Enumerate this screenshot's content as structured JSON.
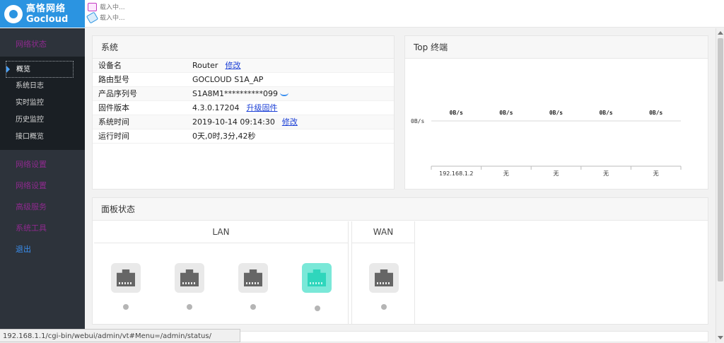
{
  "brand": {
    "name_cn": "高恪网络",
    "name_en": "Gocloud"
  },
  "loading": [
    "载入中...",
    "载入中..."
  ],
  "sidebar": {
    "status_head": "网络状态",
    "sub_items": [
      "概览",
      "系统日志",
      "实时监控",
      "历史监控",
      "接口概览"
    ],
    "items": [
      "网络设置",
      "网络设置",
      "高级服务",
      "系统工具"
    ],
    "exit": "退出"
  },
  "system": {
    "title": "系统",
    "rows": [
      {
        "label": "设备名",
        "value": "Router",
        "link": "修改"
      },
      {
        "label": "路由型号",
        "value": "GOCLOUD S1A_AP",
        "link": ""
      },
      {
        "label": "产品序列号",
        "value": "S1A8M1**********099",
        "link": ""
      },
      {
        "label": "固件版本",
        "value": "4.3.0.17204",
        "link": "升级固件"
      },
      {
        "label": "系统时间",
        "value": "2019-10-14 09:14:30",
        "link": "修改"
      },
      {
        "label": "运行时间",
        "value": "0天,0时,3分,42秒",
        "link": ""
      }
    ]
  },
  "top_terminals": {
    "title": "Top 终端",
    "y_label": "0B/s",
    "speed_labels": [
      "0B/s",
      "0B/s",
      "0B/s",
      "0B/s",
      "0B/s"
    ],
    "x_labels": [
      "192.168.1.2",
      "无",
      "无",
      "无",
      "无"
    ]
  },
  "chart_data": {
    "type": "bar",
    "title": "Top 终端",
    "categories": [
      "192.168.1.2",
      "无",
      "无",
      "无",
      "无"
    ],
    "values": [
      0,
      0,
      0,
      0,
      0
    ],
    "data_labels": [
      "0B/s",
      "0B/s",
      "0B/s",
      "0B/s",
      "0B/s"
    ],
    "ylabel": "",
    "y_tick": "0B/s"
  },
  "panel_status": {
    "title": "面板状态",
    "lan_label": "LAN",
    "wan_label": "WAN",
    "lan_ports": [
      {
        "active": false
      },
      {
        "active": false
      },
      {
        "active": false
      },
      {
        "active": true
      }
    ],
    "wan_ports": [
      {
        "active": false
      }
    ]
  },
  "statusbar": {
    "url": "192.168.1.1/cgi-bin/webui/admin/vt#Menu=/admin/status/"
  },
  "colors": {
    "brand": "#2b94e1",
    "sidebar": "#2d333b",
    "menu_text": "#8e2a8e",
    "port_active": "#2fd6bc",
    "link": "#1b3fd6"
  }
}
